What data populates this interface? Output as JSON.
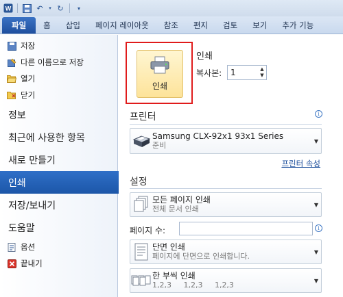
{
  "quick_access": {
    "icons": [
      "word-logo-icon",
      "save-icon",
      "undo-icon",
      "redo-icon",
      "customize-icon"
    ]
  },
  "tabs": [
    {
      "label": "파일",
      "active": true
    },
    {
      "label": "홈"
    },
    {
      "label": "삽입"
    },
    {
      "label": "페이지 레이아웃"
    },
    {
      "label": "참조"
    },
    {
      "label": "편지"
    },
    {
      "label": "검토"
    },
    {
      "label": "보기"
    },
    {
      "label": "추가 기능"
    }
  ],
  "nav": {
    "save": "저장",
    "save_as": "다른 이름으로 저장",
    "open": "열기",
    "close": "닫기",
    "info": "정보",
    "recent": "최근에 사용한 항목",
    "new": "새로 만들기",
    "print": "인쇄",
    "save_send": "저장/보내기",
    "help": "도움말",
    "options": "옵션",
    "exit": "끝내기"
  },
  "print_panel": {
    "print_button": "인쇄",
    "title": "인쇄",
    "copies_label": "복사본:",
    "copies_value": "1"
  },
  "printer": {
    "section_title": "프린터",
    "name": "Samsung CLX-92x1 93x1 Series",
    "status": "준비",
    "properties_link": "프린터 속성"
  },
  "settings": {
    "section_title": "설정",
    "print_range_main": "모든 페이지 인쇄",
    "print_range_sub": "전체 문서 인쇄",
    "pages_label": "페이지 수:",
    "pages_value": "",
    "sides_main": "단면 인쇄",
    "sides_sub": "페이지에 단면으로 인쇄합니다.",
    "collate_main": "한 부씩 인쇄",
    "collate_sub": "1,2,3     1,2,3     1,2,3"
  },
  "colors": {
    "accent": "#2b5797",
    "file_tab": "#2a62b5",
    "highlight": "#e01b1b",
    "print_button": "#fde39a"
  }
}
